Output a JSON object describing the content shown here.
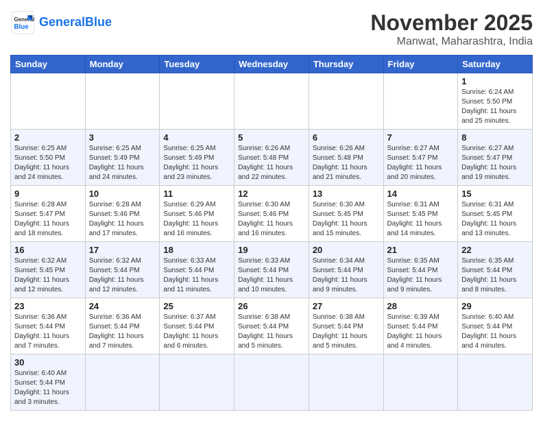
{
  "header": {
    "logo_general": "General",
    "logo_blue": "Blue",
    "month": "November 2025",
    "location": "Manwat, Maharashtra, India"
  },
  "weekdays": [
    "Sunday",
    "Monday",
    "Tuesday",
    "Wednesday",
    "Thursday",
    "Friday",
    "Saturday"
  ],
  "weeks": [
    [
      {
        "day": "",
        "info": ""
      },
      {
        "day": "",
        "info": ""
      },
      {
        "day": "",
        "info": ""
      },
      {
        "day": "",
        "info": ""
      },
      {
        "day": "",
        "info": ""
      },
      {
        "day": "",
        "info": ""
      },
      {
        "day": "1",
        "info": "Sunrise: 6:24 AM\nSunset: 5:50 PM\nDaylight: 11 hours\nand 25 minutes."
      }
    ],
    [
      {
        "day": "2",
        "info": "Sunrise: 6:25 AM\nSunset: 5:50 PM\nDaylight: 11 hours\nand 24 minutes."
      },
      {
        "day": "3",
        "info": "Sunrise: 6:25 AM\nSunset: 5:49 PM\nDaylight: 11 hours\nand 24 minutes."
      },
      {
        "day": "4",
        "info": "Sunrise: 6:25 AM\nSunset: 5:49 PM\nDaylight: 11 hours\nand 23 minutes."
      },
      {
        "day": "5",
        "info": "Sunrise: 6:26 AM\nSunset: 5:48 PM\nDaylight: 11 hours\nand 22 minutes."
      },
      {
        "day": "6",
        "info": "Sunrise: 6:26 AM\nSunset: 5:48 PM\nDaylight: 11 hours\nand 21 minutes."
      },
      {
        "day": "7",
        "info": "Sunrise: 6:27 AM\nSunset: 5:47 PM\nDaylight: 11 hours\nand 20 minutes."
      },
      {
        "day": "8",
        "info": "Sunrise: 6:27 AM\nSunset: 5:47 PM\nDaylight: 11 hours\nand 19 minutes."
      }
    ],
    [
      {
        "day": "9",
        "info": "Sunrise: 6:28 AM\nSunset: 5:47 PM\nDaylight: 11 hours\nand 18 minutes."
      },
      {
        "day": "10",
        "info": "Sunrise: 6:28 AM\nSunset: 5:46 PM\nDaylight: 11 hours\nand 17 minutes."
      },
      {
        "day": "11",
        "info": "Sunrise: 6:29 AM\nSunset: 5:46 PM\nDaylight: 11 hours\nand 16 minutes."
      },
      {
        "day": "12",
        "info": "Sunrise: 6:30 AM\nSunset: 5:46 PM\nDaylight: 11 hours\nand 16 minutes."
      },
      {
        "day": "13",
        "info": "Sunrise: 6:30 AM\nSunset: 5:45 PM\nDaylight: 11 hours\nand 15 minutes."
      },
      {
        "day": "14",
        "info": "Sunrise: 6:31 AM\nSunset: 5:45 PM\nDaylight: 11 hours\nand 14 minutes."
      },
      {
        "day": "15",
        "info": "Sunrise: 6:31 AM\nSunset: 5:45 PM\nDaylight: 11 hours\nand 13 minutes."
      }
    ],
    [
      {
        "day": "16",
        "info": "Sunrise: 6:32 AM\nSunset: 5:45 PM\nDaylight: 11 hours\nand 12 minutes."
      },
      {
        "day": "17",
        "info": "Sunrise: 6:32 AM\nSunset: 5:44 PM\nDaylight: 11 hours\nand 12 minutes."
      },
      {
        "day": "18",
        "info": "Sunrise: 6:33 AM\nSunset: 5:44 PM\nDaylight: 11 hours\nand 11 minutes."
      },
      {
        "day": "19",
        "info": "Sunrise: 6:33 AM\nSunset: 5:44 PM\nDaylight: 11 hours\nand 10 minutes."
      },
      {
        "day": "20",
        "info": "Sunrise: 6:34 AM\nSunset: 5:44 PM\nDaylight: 11 hours\nand 9 minutes."
      },
      {
        "day": "21",
        "info": "Sunrise: 6:35 AM\nSunset: 5:44 PM\nDaylight: 11 hours\nand 9 minutes."
      },
      {
        "day": "22",
        "info": "Sunrise: 6:35 AM\nSunset: 5:44 PM\nDaylight: 11 hours\nand 8 minutes."
      }
    ],
    [
      {
        "day": "23",
        "info": "Sunrise: 6:36 AM\nSunset: 5:44 PM\nDaylight: 11 hours\nand 7 minutes."
      },
      {
        "day": "24",
        "info": "Sunrise: 6:36 AM\nSunset: 5:44 PM\nDaylight: 11 hours\nand 7 minutes."
      },
      {
        "day": "25",
        "info": "Sunrise: 6:37 AM\nSunset: 5:44 PM\nDaylight: 11 hours\nand 6 minutes."
      },
      {
        "day": "26",
        "info": "Sunrise: 6:38 AM\nSunset: 5:44 PM\nDaylight: 11 hours\nand 5 minutes."
      },
      {
        "day": "27",
        "info": "Sunrise: 6:38 AM\nSunset: 5:44 PM\nDaylight: 11 hours\nand 5 minutes."
      },
      {
        "day": "28",
        "info": "Sunrise: 6:39 AM\nSunset: 5:44 PM\nDaylight: 11 hours\nand 4 minutes."
      },
      {
        "day": "29",
        "info": "Sunrise: 6:40 AM\nSunset: 5:44 PM\nDaylight: 11 hours\nand 4 minutes."
      }
    ],
    [
      {
        "day": "30",
        "info": "Sunrise: 6:40 AM\nSunset: 5:44 PM\nDaylight: 11 hours\nand 3 minutes."
      },
      {
        "day": "",
        "info": ""
      },
      {
        "day": "",
        "info": ""
      },
      {
        "day": "",
        "info": ""
      },
      {
        "day": "",
        "info": ""
      },
      {
        "day": "",
        "info": ""
      },
      {
        "day": "",
        "info": ""
      }
    ]
  ]
}
